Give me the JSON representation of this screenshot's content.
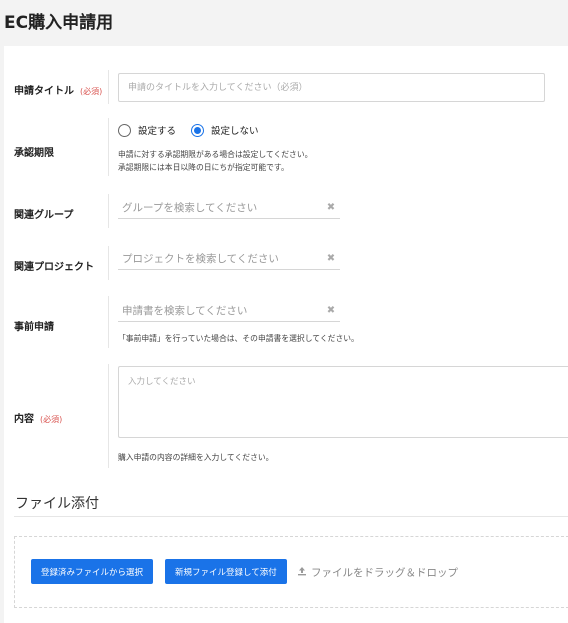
{
  "page": {
    "title": "EC購入申請用"
  },
  "form": {
    "title_field": {
      "label": "申請タイトル",
      "required": "(必須)",
      "placeholder": "申請のタイトルを入力してください（必須）"
    },
    "approval_deadline": {
      "label": "承認期限",
      "options": [
        {
          "label": "設定する",
          "selected": false
        },
        {
          "label": "設定しない",
          "selected": true
        }
      ],
      "help_lines": [
        "申請に対する承認期限がある場合は設定してください。",
        "承認期限には本日以降の日にちが指定可能です。"
      ]
    },
    "related_group": {
      "label": "関連グループ",
      "placeholder": "グループを検索してください"
    },
    "related_project": {
      "label": "関連プロジェクト",
      "placeholder": "プロジェクトを検索してください"
    },
    "pre_application": {
      "label": "事前申請",
      "placeholder": "申請書を検索してください",
      "help": "「事前申請」を行っていた場合は、その申請書を選択してください。"
    },
    "content": {
      "label": "内容",
      "required": "(必須)",
      "placeholder": "入力してください",
      "help": "購入申請の内容の詳細を入力してください。"
    }
  },
  "attachments": {
    "title": "ファイル添付",
    "select_registered_button": "登録済みファイルから選択",
    "register_new_button": "新規ファイル登録して添付",
    "drop_hint": "ファイルをドラッグ＆ドロップ",
    "icons": {
      "upload": "upload-icon",
      "clear": "close-icon"
    }
  },
  "colors": {
    "accent": "#1a73e8",
    "required": "#d9534f"
  }
}
